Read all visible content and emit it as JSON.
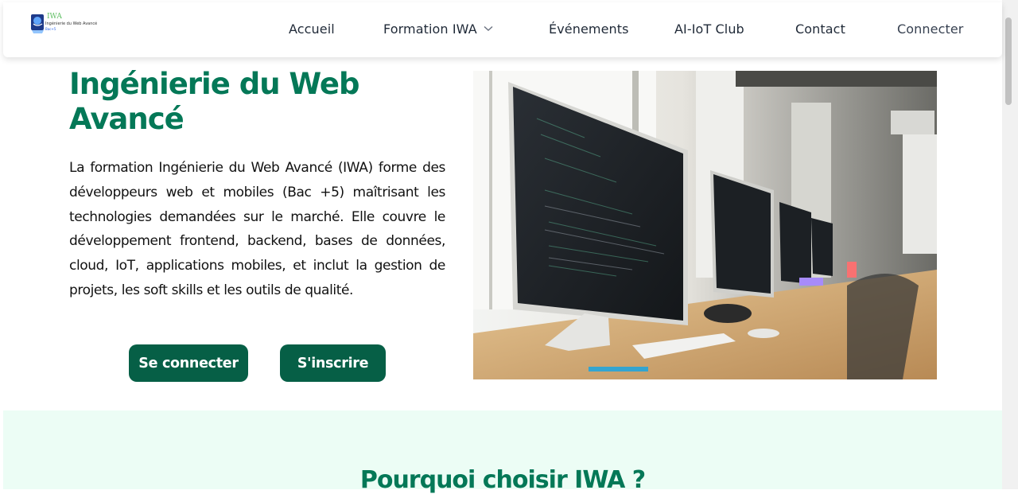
{
  "logo": {
    "line1": "IWA",
    "line2": "Ingénierie du Web Avancé",
    "line3": "Bac+5"
  },
  "nav": {
    "items": [
      {
        "label": "Accueil"
      },
      {
        "label": "Formation IWA"
      },
      {
        "label": "Événements"
      },
      {
        "label": "AI-IoT Club"
      },
      {
        "label": "Contact"
      },
      {
        "label": "Connecter"
      }
    ]
  },
  "hero": {
    "title": "Ingénierie du Web Avancé",
    "description": "La formation Ingénierie du Web Avancé (IWA) forme des développeurs web et mobiles (Bac +5) maîtrisant les technologies demandées sur le marché. Elle couvre le développement frontend, backend, bases de données, cloud, IoT, applications mobiles, et inclut la gestion de projets, les soft skills et les outils de qualité.",
    "login_label": "Se connecter",
    "signup_label": "S'inscrire"
  },
  "why": {
    "title": "Pourquoi choisir IWA ?"
  },
  "colors": {
    "accent": "#047857",
    "button": "#065f46",
    "section_bg": "#ecfdf5"
  }
}
